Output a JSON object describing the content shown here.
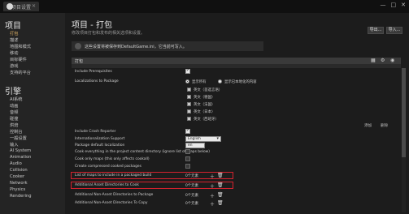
{
  "window": {
    "tab_label": "项目设置",
    "controls": [
      "—",
      "□",
      "✕"
    ]
  },
  "sidebar": {
    "section_project": "项目",
    "project_items": [
      "描述",
      "地图和模式",
      "移动",
      "目标硬件",
      "游戏",
      "支持的平台"
    ],
    "active_item": "打包",
    "section_engine": "引擎",
    "engine_items": [
      "AI系统",
      "动画",
      "音频",
      "碰撞",
      "烘焙",
      "控制台",
      "一般设置",
      "输入",
      "导航网格",
      "导航系统",
      "网络",
      "物理",
      "渲染",
      "AI System",
      "Animation",
      "Audio",
      "Collision",
      "Cooker",
      "Network",
      "Physics",
      "Rendering"
    ]
  },
  "header": {
    "title": "项目 - 打包",
    "description": "修改项目打包和发布的相关选项和设置。",
    "notice": "这些设置将被保存到DefaultGame.ini，它当前可写入。",
    "buttons": {
      "export": "导出...",
      "import": "导入..."
    }
  },
  "section": {
    "title": "打包",
    "search_placeholder": ""
  },
  "rows": {
    "include_prerequisites": "Include Prerequisites",
    "localizations": "Localizations to Package",
    "radio_show_only": "显示所有",
    "radio_show_localized": "显示已本地化的内容",
    "languages": [
      "英文（首选言语）",
      "英文（德国）",
      "英文（法国）",
      "英文（日本）",
      "英文（西班牙）",
      "英文（中国）",
      "英文（韩国）"
    ],
    "lang_suffix_2": "日本",
    "lang_suffix_3": "西班牙",
    "add_link": "添加",
    "remove_link": "删除",
    "include_crash_reporter": "Include Crash Reporter",
    "internationalization_support": "Internationalization Support",
    "internationalization_value": "English",
    "package_default_localization": "Package default localization",
    "package_default_value": "en",
    "cook_everything": "Cook everything in the project content directory (ignore list of maps below)",
    "cook_new_maps": "Cook only maps (this only affects cookall)",
    "create_compressed": "Create compressed cooked packages",
    "list_of_maps": "List of maps to include in a packaged build",
    "list_of_maps_value": "0个元素",
    "additional_asset_dirs": "Additional Asset Directories to Cook",
    "additional_asset_dirs_value": "0个元素",
    "additional_nonasset_package": "Additional Non-Asset Directories to Package",
    "additional_nonasset_package_value": "0个元素",
    "additional_nonasset_copy": "Additional Non-Asset Directories To Copy",
    "additional_nonasset_copy_value": "0个元素"
  },
  "colors": {
    "highlight": "#d6222e",
    "active_text": "#e8b86a"
  }
}
